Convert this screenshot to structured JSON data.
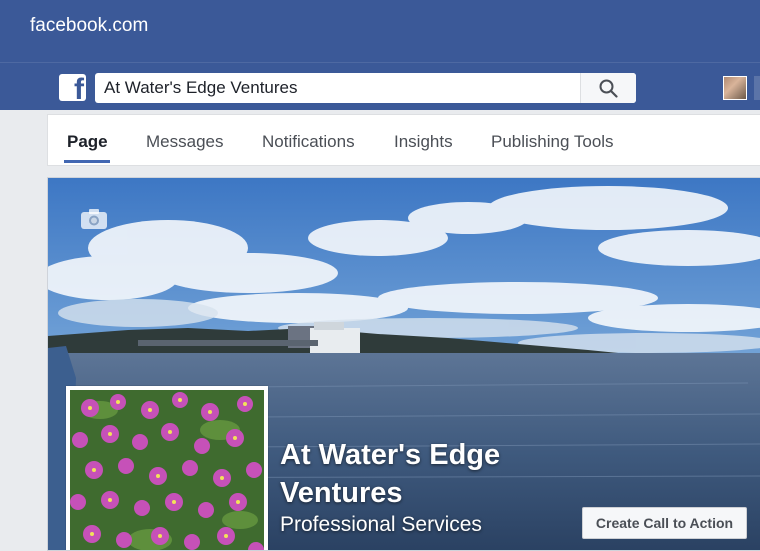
{
  "browser": {
    "url": "facebook.com"
  },
  "header": {
    "logo_icon": "facebook-f-icon",
    "search_value": "At Water's Edge Ventures",
    "search_icon": "magnifier-icon",
    "avatar_icon": "profile-photo"
  },
  "tabs": [
    {
      "label": "Page",
      "active": true
    },
    {
      "label": "Messages",
      "active": false
    },
    {
      "label": "Notifications",
      "active": false
    },
    {
      "label": "Insights",
      "active": false
    },
    {
      "label": "Publishing Tools",
      "active": false
    }
  ],
  "cover": {
    "camera_icon": "camera-icon",
    "page_name": "At Water's Edge Ventures",
    "category": "Professional Services",
    "cta_label": "Create Call to Action"
  },
  "colors": {
    "brand_blue": "#3b5998",
    "tab_accent": "#4267b2",
    "page_bg": "#e9ebee"
  }
}
